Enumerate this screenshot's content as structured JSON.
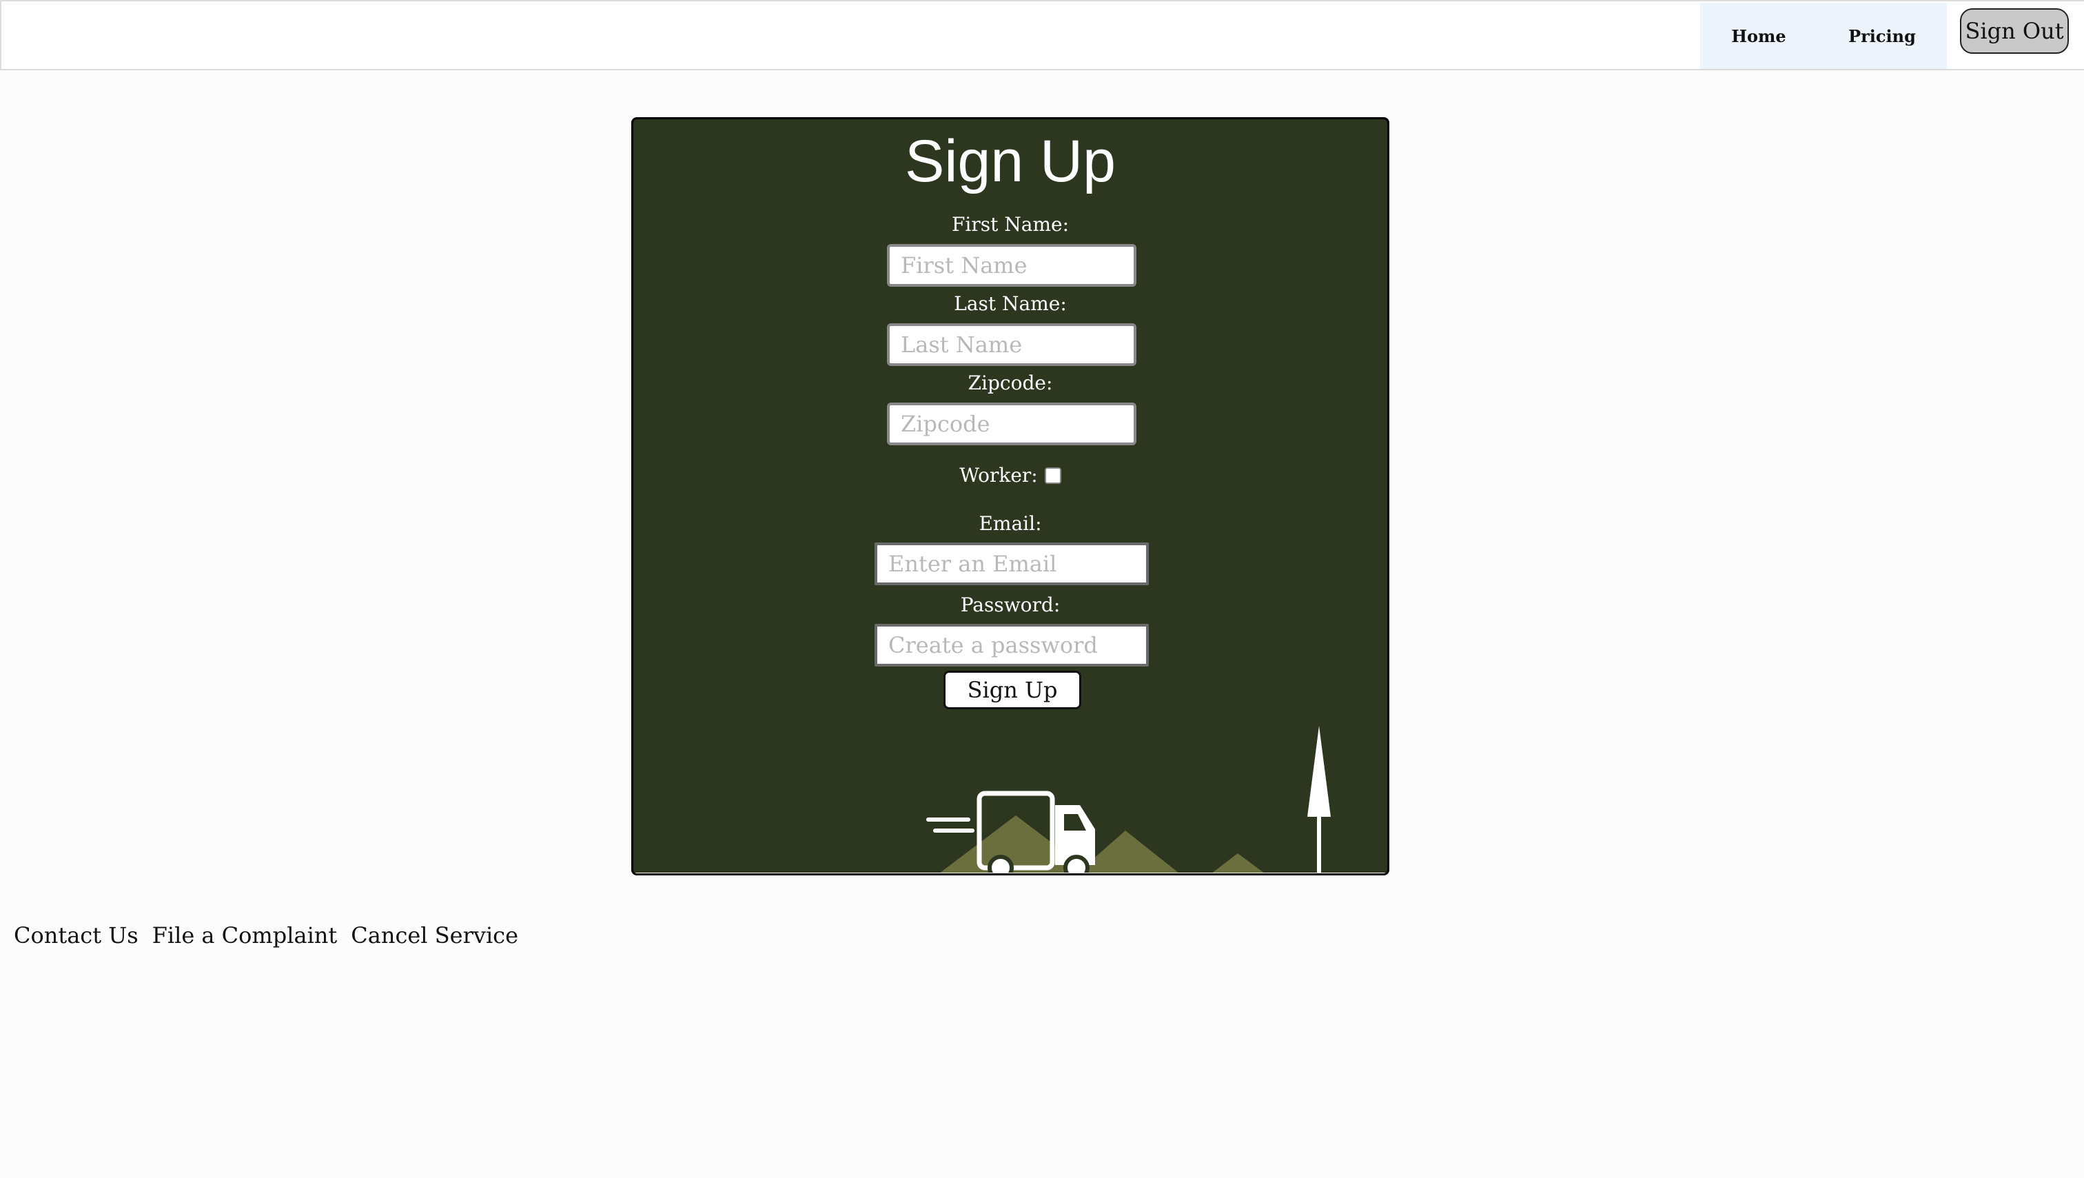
{
  "nav": {
    "home": "Home",
    "pricing": "Pricing",
    "signout": "Sign Out"
  },
  "form": {
    "title": "Sign Up",
    "first_name_label": "First Name:",
    "first_name_placeholder": "First Name",
    "last_name_label": "Last Name:",
    "last_name_placeholder": "Last Name",
    "zipcode_label": "Zipcode:",
    "zipcode_placeholder": "Zipcode",
    "worker_label": "Worker:",
    "worker_checked": false,
    "email_label": "Email:",
    "email_placeholder": "Enter an Email",
    "password_label": "Password:",
    "password_placeholder": "Create a password",
    "submit_label": "Sign Up"
  },
  "footer": {
    "links": [
      "Contact Us",
      "File a Complaint",
      "Cancel Service"
    ]
  },
  "colors": {
    "card_bg": "#2d3720",
    "mountain": "#6b6f3e",
    "nav_bg": "#eef4fc",
    "signout_bg": "#c9c9c9"
  },
  "icons": {
    "illustration": [
      "truck-icon",
      "tree-icon",
      "mountain-icon"
    ]
  }
}
